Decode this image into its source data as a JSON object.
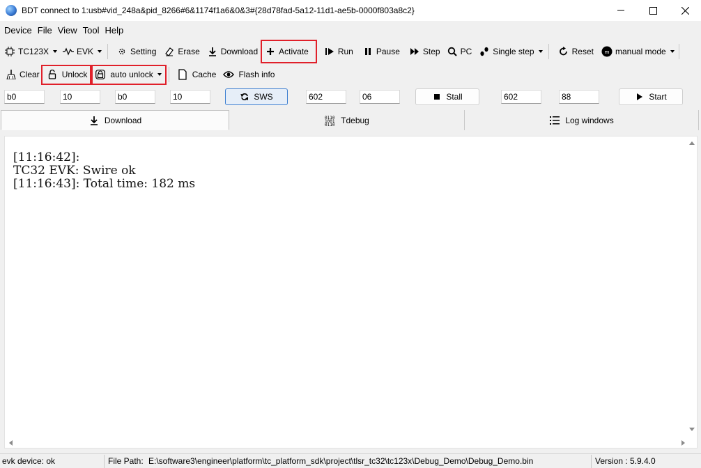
{
  "window": {
    "title": "BDT connect to 1:usb#vid_248a&pid_8266#6&1174f1a6&0&3#{28d78fad-5a12-11d1-ae5b-0000f803a8c2}"
  },
  "menu": [
    "Device",
    "File",
    "View",
    "Tool",
    "Help"
  ],
  "toolbar1": {
    "chip": "TC123X",
    "board": "EVK",
    "setting": "Setting",
    "erase": "Erase",
    "download": "Download",
    "activate": "Activate",
    "run": "Run",
    "pause": "Pause",
    "step": "Step",
    "pc": "PC",
    "single_step": "Single step",
    "reset": "Reset",
    "mode": "manual mode"
  },
  "toolbar2": {
    "clear": "Clear",
    "unlock": "Unlock",
    "auto_unlock": "auto unlock",
    "cache": "Cache",
    "flash_info": "Flash info"
  },
  "params": {
    "field1": "b0",
    "field2": "10",
    "field3": "b0",
    "field4": "10",
    "sws_label": "SWS",
    "field5": "602",
    "field6": "06",
    "stall_label": "Stall",
    "field7": "602",
    "field8": "88",
    "start_label": "Start"
  },
  "tabs": {
    "download": "Download",
    "tdebug": "Tdebug",
    "log_windows": "Log windows"
  },
  "log": {
    "lines": [
      "[11:16:42]:",
      "TC32 EVK: Swire ok",
      "[11:16:43]: Total time: 182 ms"
    ]
  },
  "status": {
    "device": "evk device: ok",
    "file_path_label": "File Path:",
    "file_path": "E:\\software3\\engineer\\platform\\tc_platform_sdk\\project\\tlsr_tc32\\tc123x\\Debug_Demo\\Debug_Demo.bin",
    "version": "Version : 5.9.4.0"
  },
  "colors": {
    "highlight": "#e0202a",
    "sws_button_border": "#3c7ed0"
  }
}
